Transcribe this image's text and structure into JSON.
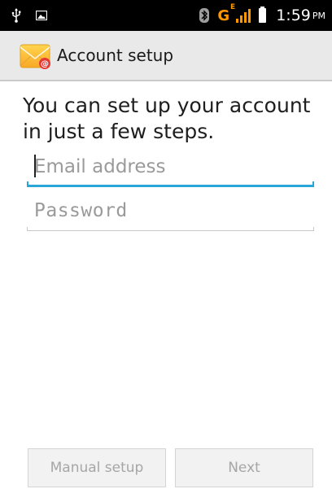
{
  "status_bar": {
    "usb_icon": "usb-icon",
    "image_icon": "image-notification-icon",
    "bluetooth_icon": "bluetooth-icon",
    "network_type": "G",
    "network_sub": "E",
    "time": "1:59",
    "ampm": "PM",
    "accent_color": "#ff9800"
  },
  "action_bar": {
    "icon": "email-app-icon",
    "title": "Account setup"
  },
  "content": {
    "instructions": "You can set up your account in just a few steps."
  },
  "fields": {
    "email": {
      "value": "",
      "placeholder": "Email address",
      "focused": true,
      "accent": "#29a5d8"
    },
    "password": {
      "value": "",
      "placeholder": "Password"
    }
  },
  "buttons": {
    "manual_setup": "Manual setup",
    "next": "Next"
  }
}
